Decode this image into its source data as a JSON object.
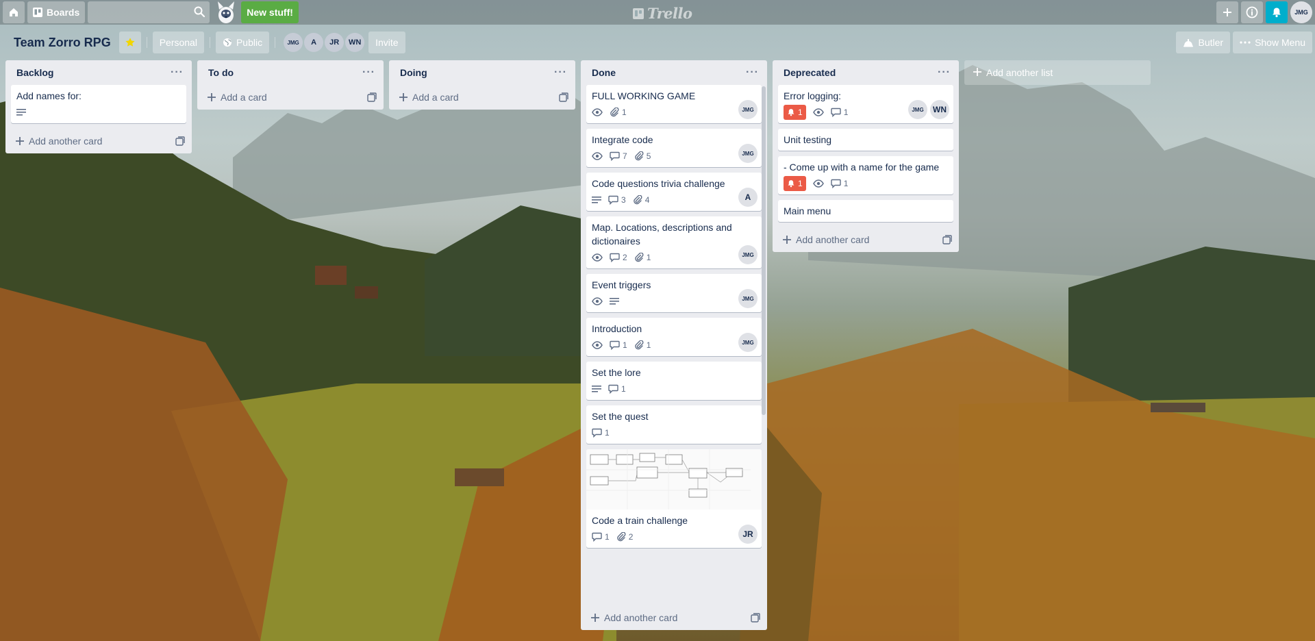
{
  "header": {
    "boards_label": "Boards",
    "search_value": "",
    "new_stuff_label": "New stuff!",
    "logo_text": "Trello",
    "user_initials": "JMG"
  },
  "board": {
    "title": "Team Zorro RPG",
    "personal_label": "Personal",
    "visibility_label": "Public",
    "members": [
      "JMG",
      "A",
      "JR",
      "WN"
    ],
    "invite_label": "Invite",
    "butler_label": "Butler",
    "show_menu_label": "Show Menu"
  },
  "lists": [
    {
      "title": "Backlog",
      "cards": [
        {
          "title": "Add names for:",
          "description": true
        }
      ],
      "add_label": "Add another card"
    },
    {
      "title": "To do",
      "cards": [],
      "add_label": "Add a card"
    },
    {
      "title": "Doing",
      "cards": [],
      "add_label": "Add a card"
    },
    {
      "title": "Done",
      "cards": [
        {
          "title": "FULL WORKING GAME",
          "watch": true,
          "attachments": "1",
          "members": [
            "JMG"
          ]
        },
        {
          "title": "Integrate code",
          "watch": true,
          "comments": "7",
          "attachments": "5",
          "members": [
            "JMG"
          ]
        },
        {
          "title": "Code questions trivia challenge",
          "description": true,
          "comments": "3",
          "attachments": "4",
          "members": [
            "A"
          ]
        },
        {
          "title": "Map. Locations, descriptions and dictionaires",
          "watch": true,
          "comments": "2",
          "attachments": "1",
          "members": [
            "JMG"
          ]
        },
        {
          "title": "Event triggers",
          "watch": true,
          "description": true,
          "members": [
            "JMG"
          ]
        },
        {
          "title": "Introduction",
          "watch": true,
          "comments": "1",
          "attachments": "1",
          "members": [
            "JMG"
          ]
        },
        {
          "title": "Set the lore",
          "description": true,
          "comments": "1"
        },
        {
          "title": "Set the quest",
          "comments": "1"
        },
        {
          "title": "Code a train challenge",
          "cover": true,
          "comments": "1",
          "attachments": "2",
          "members": [
            "JR"
          ]
        }
      ],
      "add_label": "Add another card"
    },
    {
      "title": "Deprecated",
      "cards": [
        {
          "title": "Error logging:",
          "due": "1",
          "watch": true,
          "comments": "1",
          "members": [
            "JMG",
            "WN"
          ]
        },
        {
          "title": "Unit testing"
        },
        {
          "title": "- Come up with a name for the game",
          "due": "1",
          "watch": true,
          "comments": "1"
        },
        {
          "title": "Main menu"
        }
      ],
      "add_label": "Add another card"
    }
  ],
  "add_list_label": "Add another list",
  "colors": {
    "header_overlay": "rgba(0,0,0,0.22)",
    "list_bg": "#ebecf0",
    "new_stuff": "#5aac44",
    "notification": "#00aecc",
    "due_badge": "#eb5a46"
  }
}
